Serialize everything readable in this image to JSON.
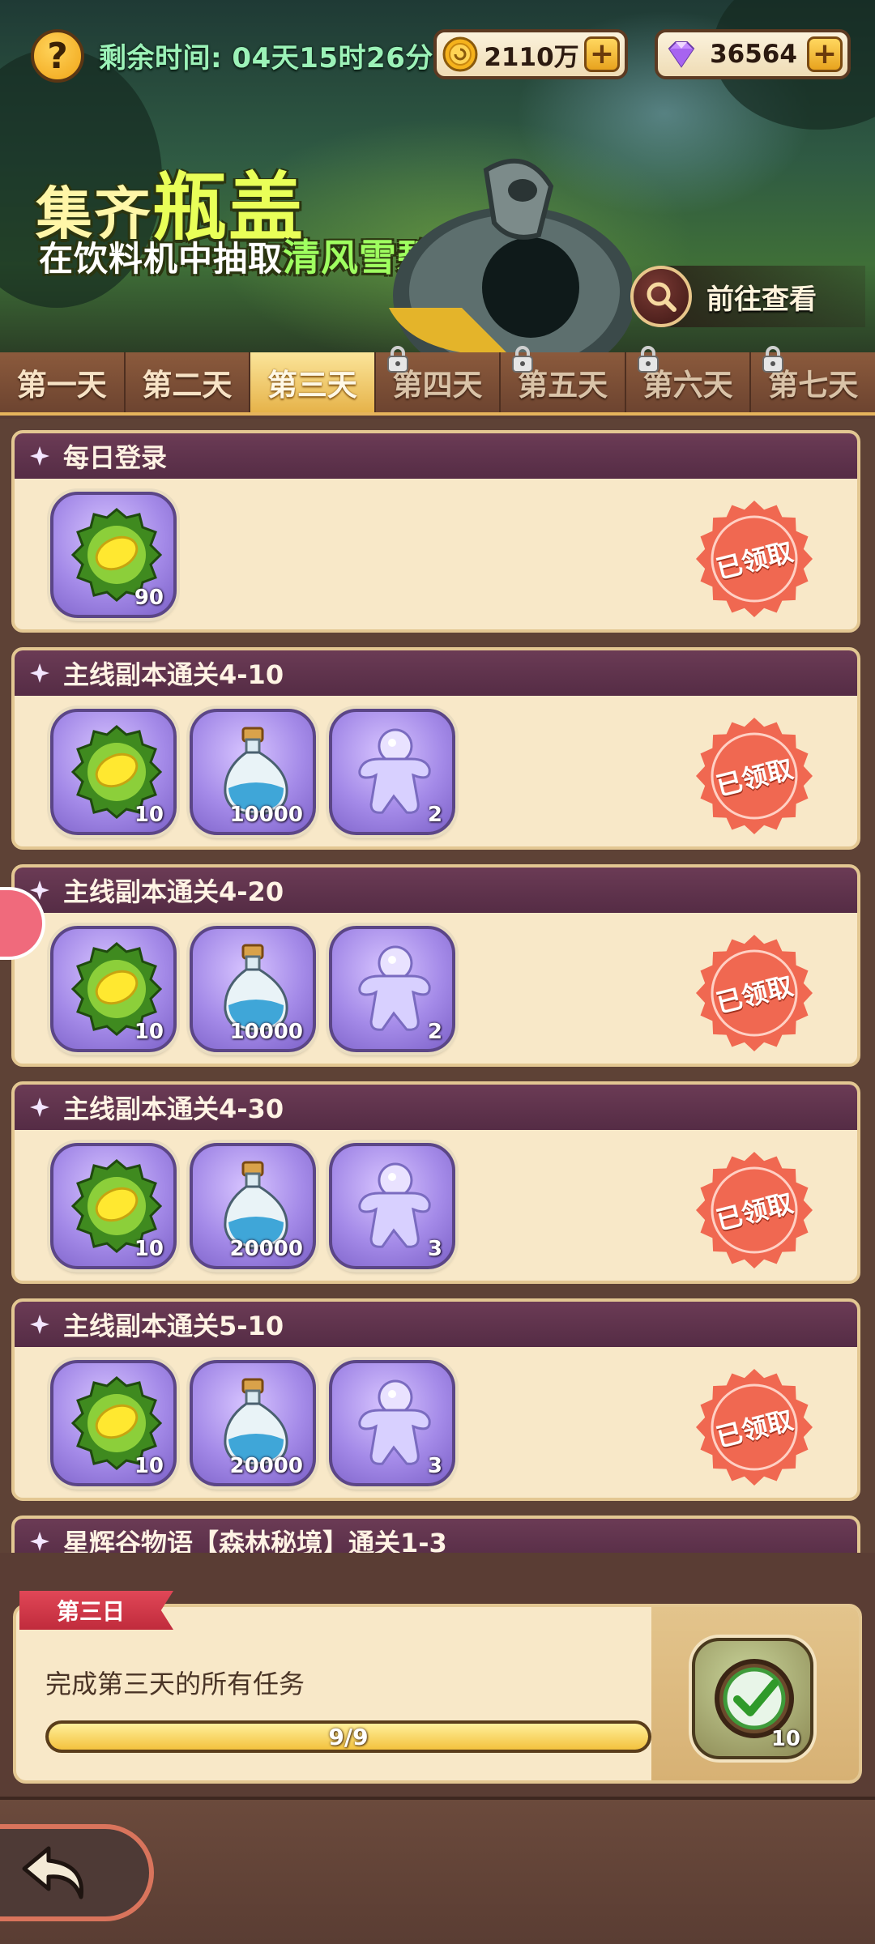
{
  "header": {
    "timer_text": "剩余时间: 04天15时26分",
    "gold": "2110万",
    "gems": "36564",
    "plus": "+",
    "help": "?"
  },
  "banner": {
    "title_prefix": "集齐",
    "title_highlight": "瓶盖",
    "subtitle_prefix": "在饮料机中抽取",
    "subtitle_highlight": "清风雪碧",
    "goto_label": "前往查看"
  },
  "tabs": [
    {
      "label": "第一天",
      "locked": false,
      "active": false
    },
    {
      "label": "第二天",
      "locked": false,
      "active": false
    },
    {
      "label": "第三天",
      "locked": false,
      "active": true
    },
    {
      "label": "第四天",
      "locked": true,
      "active": false
    },
    {
      "label": "第五天",
      "locked": true,
      "active": false
    },
    {
      "label": "第六天",
      "locked": true,
      "active": false
    },
    {
      "label": "第七天",
      "locked": true,
      "active": false
    }
  ],
  "tasks": [
    {
      "title": "每日登录",
      "status": "已领取",
      "rewards": [
        {
          "icon": "bottle-cap-icon",
          "qty": "90"
        }
      ]
    },
    {
      "title": "主线副本通关4-10",
      "status": "已领取",
      "rewards": [
        {
          "icon": "bottle-cap-icon",
          "qty": "10"
        },
        {
          "icon": "potion-bottle-icon",
          "qty": "10000"
        },
        {
          "icon": "jelly-figure-icon",
          "qty": "2"
        }
      ]
    },
    {
      "title": "主线副本通关4-20",
      "status": "已领取",
      "rewards": [
        {
          "icon": "bottle-cap-icon",
          "qty": "10"
        },
        {
          "icon": "potion-bottle-icon",
          "qty": "10000"
        },
        {
          "icon": "jelly-figure-icon",
          "qty": "2"
        }
      ]
    },
    {
      "title": "主线副本通关4-30",
      "status": "已领取",
      "rewards": [
        {
          "icon": "bottle-cap-icon",
          "qty": "10"
        },
        {
          "icon": "potion-bottle-icon",
          "qty": "20000"
        },
        {
          "icon": "jelly-figure-icon",
          "qty": "3"
        }
      ]
    },
    {
      "title": "主线副本通关5-10",
      "status": "已领取",
      "rewards": [
        {
          "icon": "bottle-cap-icon",
          "qty": "10"
        },
        {
          "icon": "potion-bottle-icon",
          "qty": "20000"
        },
        {
          "icon": "jelly-figure-icon",
          "qty": "3"
        }
      ]
    },
    {
      "title": "星辉谷物语【森林秘境】通关1-3"
    }
  ],
  "day_summary": {
    "ribbon": "第三日",
    "description": "完成第三天的所有任务",
    "progress_text": "9/9",
    "progress_fraction": 1.0,
    "reward_icon": "checkmark-badge-icon",
    "reward_qty": "10"
  },
  "colors": {
    "accent_gold": "#f3c23e",
    "card_bg": "#f8e8c8",
    "card_header": "#6b3b55",
    "stamp_red": "#ee5a44",
    "timer_green": "#9cf2b8"
  }
}
